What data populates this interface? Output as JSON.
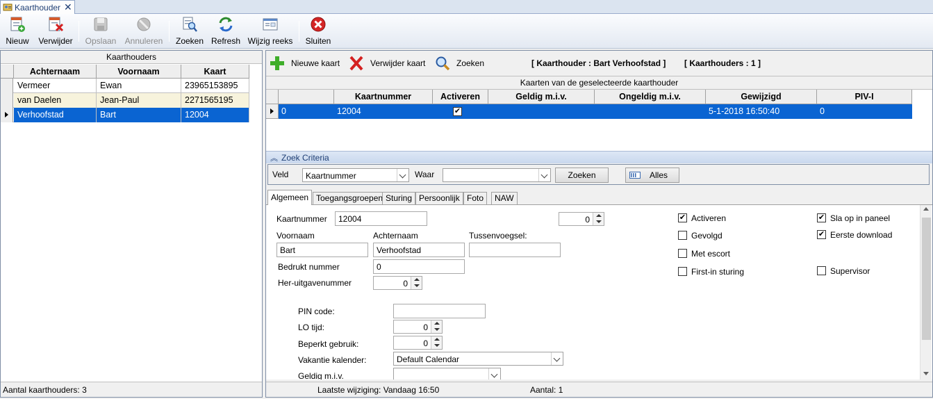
{
  "tab": {
    "label": "Kaarthouder"
  },
  "toolbar": {
    "nieuw": "Nieuw",
    "verwijder": "Verwijder",
    "opslaan": "Opslaan",
    "annuleren": "Annuleren",
    "zoeken": "Zoeken",
    "refresh": "Refresh",
    "wijzig_reeks": "Wijzig reeks",
    "sluiten": "Sluiten"
  },
  "left": {
    "caption": "Kaarthouders",
    "columns": [
      "Achternaam",
      "Voornaam",
      "Kaart"
    ],
    "rows": [
      [
        "Vermeer",
        "Ewan",
        "23965153895"
      ],
      [
        "van Daelen",
        "Jean-Paul",
        "2271565195"
      ],
      [
        "Verhoofstad",
        "Bart",
        "12004"
      ]
    ],
    "status": "Aantal kaarthouders: 3"
  },
  "right_toolbar": {
    "nieuwe_kaart": "Nieuwe kaart",
    "verwijder_kaart": "Verwijder kaart",
    "zoeken": "Zoeken",
    "info_kaarthouder": "[ Kaarthouder : Bart Verhoofstad ]",
    "info_count": "[ Kaarthouders : 1 ]"
  },
  "cards": {
    "caption": "Kaarten van de geselecteerde kaarthouder",
    "columns": [
      "Kaartnummer",
      "Activeren",
      "Geldig m.i.v.",
      "Ongeldig m.i.v.",
      "Gewijzigd",
      "PIV-I"
    ],
    "row": {
      "id": "0",
      "kaartnummer": "12004",
      "activeren": true,
      "geldig": "",
      "ongeldig": "",
      "gewijzigd": "5-1-2018 16:50:40",
      "pivi": "0"
    }
  },
  "zoek": {
    "title": "Zoek Criteria",
    "veld_label": "Veld",
    "veld_value": "Kaartnummer",
    "waar_label": "Waar",
    "waar_value": "",
    "zoeken_btn": "Zoeken",
    "alles_btn": "Alles"
  },
  "tabs": [
    "Algemeen",
    "Toegangsgroepen",
    "Sturing",
    "Persoonlijk",
    "Foto",
    "NAW"
  ],
  "form": {
    "kaartnummer_label": "Kaartnummer",
    "kaartnummer": "12004",
    "extra_num": "0",
    "voornaam_label": "Voornaam",
    "voornaam": "Bart",
    "achternaam_label": "Achternaam",
    "achternaam": "Verhoofstad",
    "tussen_label": "Tussenvoegsel:",
    "tussen": "",
    "bedrukt_label": "Bedrukt nummer",
    "bedrukt": "0",
    "heruit_label": "Her-uitgavenummer",
    "heruit": "0",
    "pin_label": "PIN code:",
    "pin": "",
    "lo_label": "LO tijd:",
    "lo": "0",
    "beperkt_label": "Beperkt gebruik:",
    "beperkt": "0",
    "vakantie_label": "Vakantie kalender:",
    "vakantie": "Default Calendar",
    "geldig_label": "Geldig m.i.v.",
    "geldig": ""
  },
  "checks": {
    "activeren": {
      "label": "Activeren",
      "checked": true
    },
    "gevolgd": {
      "label": "Gevolgd",
      "checked": false
    },
    "met_escort": {
      "label": "Met escort",
      "checked": false
    },
    "first_in": {
      "label": "First-in sturing",
      "checked": false
    },
    "sla_op": {
      "label": "Sla op in paneel",
      "checked": true
    },
    "eerste_download": {
      "label": "Eerste download",
      "checked": true
    },
    "supervisor": {
      "label": "Supervisor",
      "checked": false
    }
  },
  "status": {
    "laatste": "Laatste wijziging: Vandaag 16:50",
    "aantal": "Aantal: 1"
  }
}
